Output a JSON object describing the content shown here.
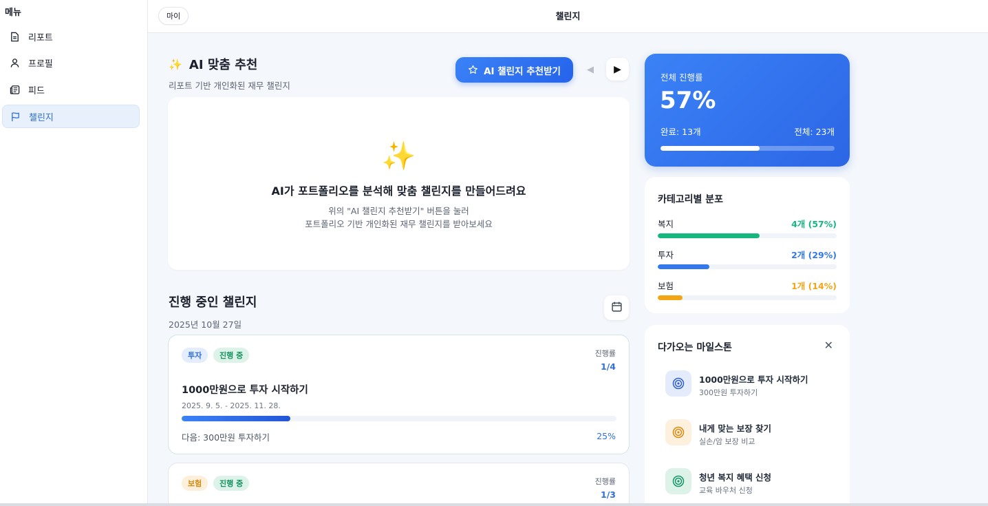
{
  "sidebar": {
    "title": "메뉴",
    "items": [
      {
        "label": "리포트",
        "icon": "document-icon"
      },
      {
        "label": "프로필",
        "icon": "user-icon"
      },
      {
        "label": "피드",
        "icon": "newspaper-icon"
      },
      {
        "label": "챌린지",
        "icon": "flag-icon"
      }
    ],
    "active_index": 3
  },
  "header": {
    "my_label": "마이",
    "title": "챌린지"
  },
  "ai": {
    "title": "AI 맞춤 추천",
    "subtitle": "리포트 기반 개인화된 재무 챌린지",
    "button_label": "AI 챌린지 추천받기",
    "prev_symbol": "◀",
    "next_symbol": "▶",
    "empty_title": "AI가 포트폴리오를 분석해 맞춤 챌린지를 만들어드려요",
    "empty_line1": "위의 \"AI 챌린지 추천받기\" 버튼을 눌러",
    "empty_line2": "포트폴리오 기반 개인화된 재무 챌린지를 받아보세요"
  },
  "progress_section": {
    "title": "진행 중인 챌린지",
    "date": "2025년 10월 27일"
  },
  "challenges": [
    {
      "category": "투자",
      "status": "진행 중",
      "rate_label": "진행률",
      "rate_value": "1/4",
      "name": "1000만원으로 투자 시작하기",
      "period": "2025. 9. 5. - 2025. 11. 28.",
      "progress": 0.25,
      "next": "다음: 300만원 투자하기",
      "percent": "25%"
    },
    {
      "category": "보험",
      "status": "진행 중",
      "rate_label": "진행률",
      "rate_value": "1/3"
    }
  ],
  "overall": {
    "label": "전체 진행률",
    "value": "57%",
    "progress": 0.57,
    "done": "완료: 13개",
    "total": "전체: 23개"
  },
  "categories": {
    "title": "카테고리별 분포",
    "rows": [
      {
        "name": "복지",
        "count": "4개 (57%)",
        "fraction": 0.57,
        "color": "#16b67f"
      },
      {
        "name": "투자",
        "count": "2개 (29%)",
        "fraction": 0.29,
        "color": "#3479ec"
      },
      {
        "name": "보험",
        "count": "1개 (14%)",
        "fraction": 0.14,
        "color": "#f2a516"
      }
    ]
  },
  "milestones": {
    "title": "다가오는 마일스톤",
    "items": [
      {
        "name": "1000만원으로 투자 시작하기",
        "sub": "300만원 투자하기",
        "color": "#2f5fd0",
        "bg": "#e4ecfb"
      },
      {
        "name": "내게 맞는 보장 찾기",
        "sub": "실손/암 보장 비교",
        "color": "#d98a12",
        "bg": "#fdf0dc"
      },
      {
        "name": "청년 복지 혜택 신청",
        "sub": "교육 바우처 신청",
        "color": "#149566",
        "bg": "#ddf3ea"
      }
    ]
  }
}
